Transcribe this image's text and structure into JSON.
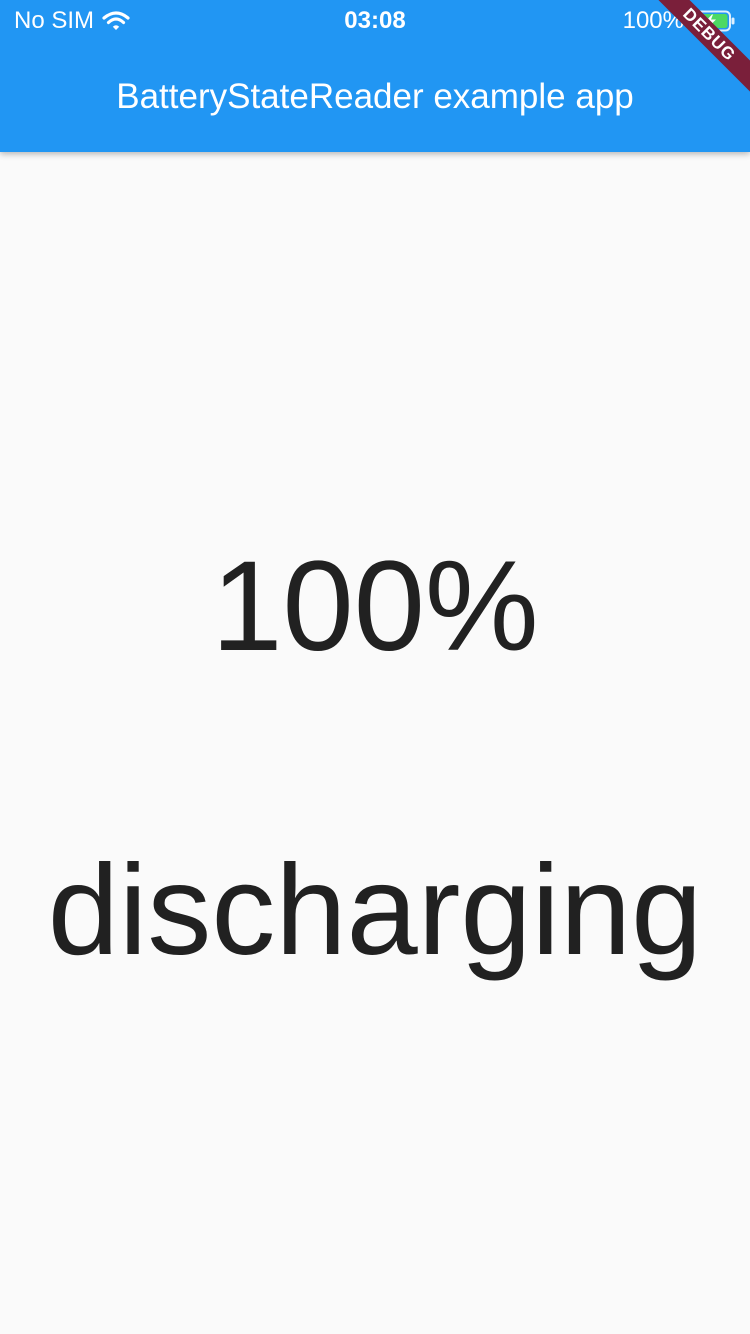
{
  "status_bar": {
    "carrier": "No SIM",
    "wifi_icon": "wifi-icon",
    "time": "03:08",
    "battery_percent": "100%",
    "battery_icon": "battery-charging-icon",
    "battery_fill_color": "#4cd964"
  },
  "app_bar": {
    "title": "BatteryStateReader example app",
    "color": "#2196f3"
  },
  "debug_banner": {
    "label": "DEBUG",
    "color": "#7a1f3a"
  },
  "main": {
    "battery_level": "100%",
    "battery_state": "discharging"
  }
}
